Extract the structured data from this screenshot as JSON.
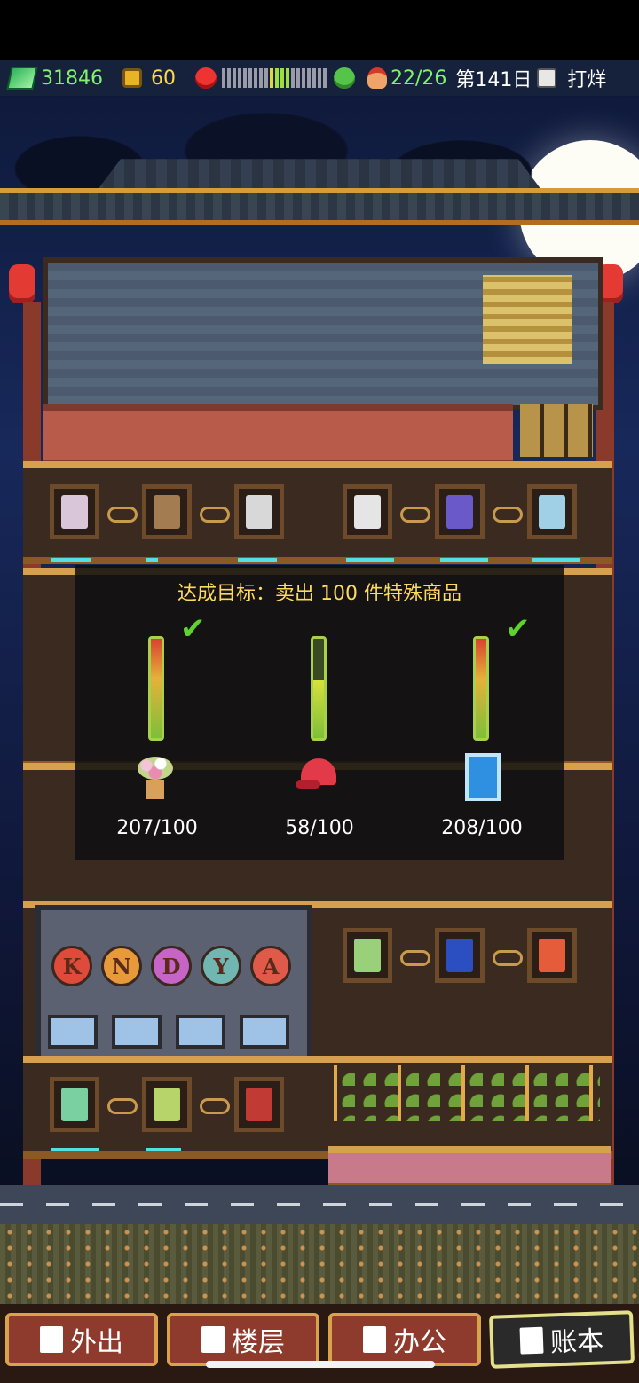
{
  "hud": {
    "money": "31846",
    "coins": "60",
    "staff": "22/26",
    "day": "第141日",
    "status": "打烊",
    "mood_level": 0.55
  },
  "goal": {
    "title": "达成目标：卖出 100 件特殊商品",
    "items": [
      {
        "icon": "flower-bouquet-icon",
        "count": "207/100",
        "achieved": true,
        "fill": 1.0
      },
      {
        "icon": "red-cap-icon",
        "count": "58/100",
        "achieved": false,
        "fill": 0.58
      },
      {
        "icon": "blue-tablet-icon",
        "count": "208/100",
        "achieved": true,
        "fill": 1.0
      }
    ]
  },
  "vending": {
    "letters": [
      "K",
      "N",
      "D",
      "Y",
      "A"
    ]
  },
  "nav": {
    "out": "外出",
    "floors": "楼层",
    "office": "办公",
    "ledger": "账本"
  },
  "colors": {
    "money": "#7ff36f",
    "coins": "#ffd84a",
    "goal_title": "#ffd95c",
    "check": "#5fd22e"
  }
}
